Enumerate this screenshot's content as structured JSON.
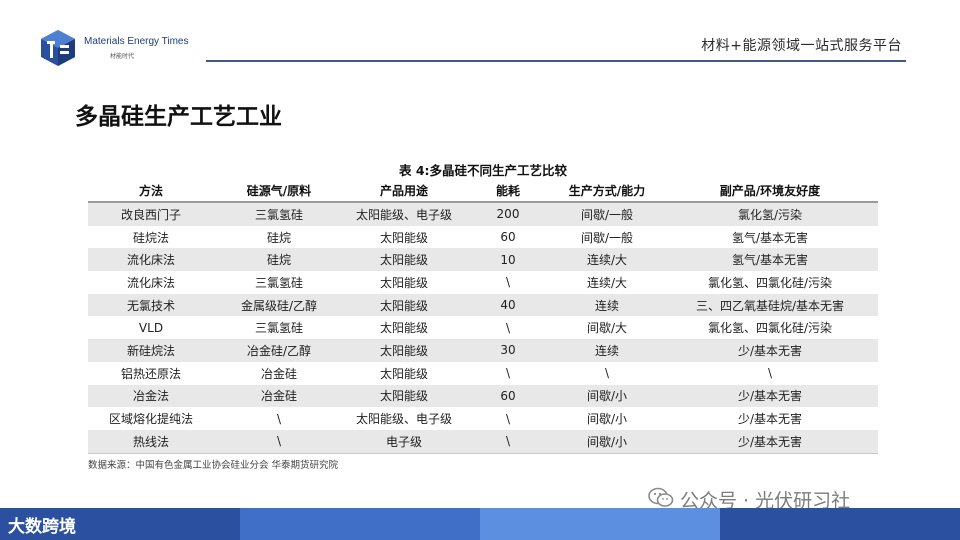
{
  "header": {
    "brand_en": "Materials Energy Times",
    "brand_cn": "材能时代",
    "tagline": "材料+能源领域一站式服务平台"
  },
  "page_title": "多晶硅生产工艺工业",
  "table": {
    "caption": "表 4:多晶硅不同生产工艺比较",
    "columns": [
      "方法",
      "硅源气/原料",
      "产品用途",
      "能耗",
      "生产方式/能力",
      "副产品/环境友好度"
    ],
    "rows": [
      [
        "改良西门子",
        "三氯氢硅",
        "太阳能级、电子级",
        "200",
        "间歇/一般",
        "氯化氢/污染"
      ],
      [
        "硅烷法",
        "硅烷",
        "太阳能级",
        "60",
        "间歇/一般",
        "氢气/基本无害"
      ],
      [
        "流化床法",
        "硅烷",
        "太阳能级",
        "10",
        "连续/大",
        "氢气/基本无害"
      ],
      [
        "流化床法",
        "三氯氢硅",
        "太阳能级",
        "\\",
        "连续/大",
        "氯化氢、四氯化硅/污染"
      ],
      [
        "无氯技术",
        "金属级硅/乙醇",
        "太阳能级",
        "40",
        "连续",
        "三、四乙氧基硅烷/基本无害"
      ],
      [
        "VLD",
        "三氯氢硅",
        "太阳能级",
        "\\",
        "间歇/大",
        "氯化氢、四氯化硅/污染"
      ],
      [
        "新硅烷法",
        "冶金硅/乙醇",
        "太阳能级",
        "30",
        "连续",
        "少/基本无害"
      ],
      [
        "铝热还原法",
        "冶金硅",
        "太阳能级",
        "\\",
        "\\",
        "\\"
      ],
      [
        "冶金法",
        "冶金硅",
        "太阳能级",
        "60",
        "间歇/小",
        "少/基本无害"
      ],
      [
        "区域熔化提纯法",
        "\\",
        "太阳能级、电子级",
        "\\",
        "间歇/小",
        "少/基本无害"
      ],
      [
        "热线法",
        "\\",
        "电子级",
        "\\",
        "间歇/小",
        "少/基本无害"
      ]
    ]
  },
  "source_note": "数据来源：中国有色金属工业协会硅业分会 华泰期货研究院",
  "watermark": "公众号 · 光伏研习社",
  "footer": {
    "brand": "大数跨境"
  },
  "icons": {
    "logo": "cube-logo-icon",
    "wechat": "wechat-icon"
  },
  "colors": {
    "accent": "#2b50a0",
    "rule": "#3e5a8a",
    "row_shade": "#e8e8e8"
  }
}
